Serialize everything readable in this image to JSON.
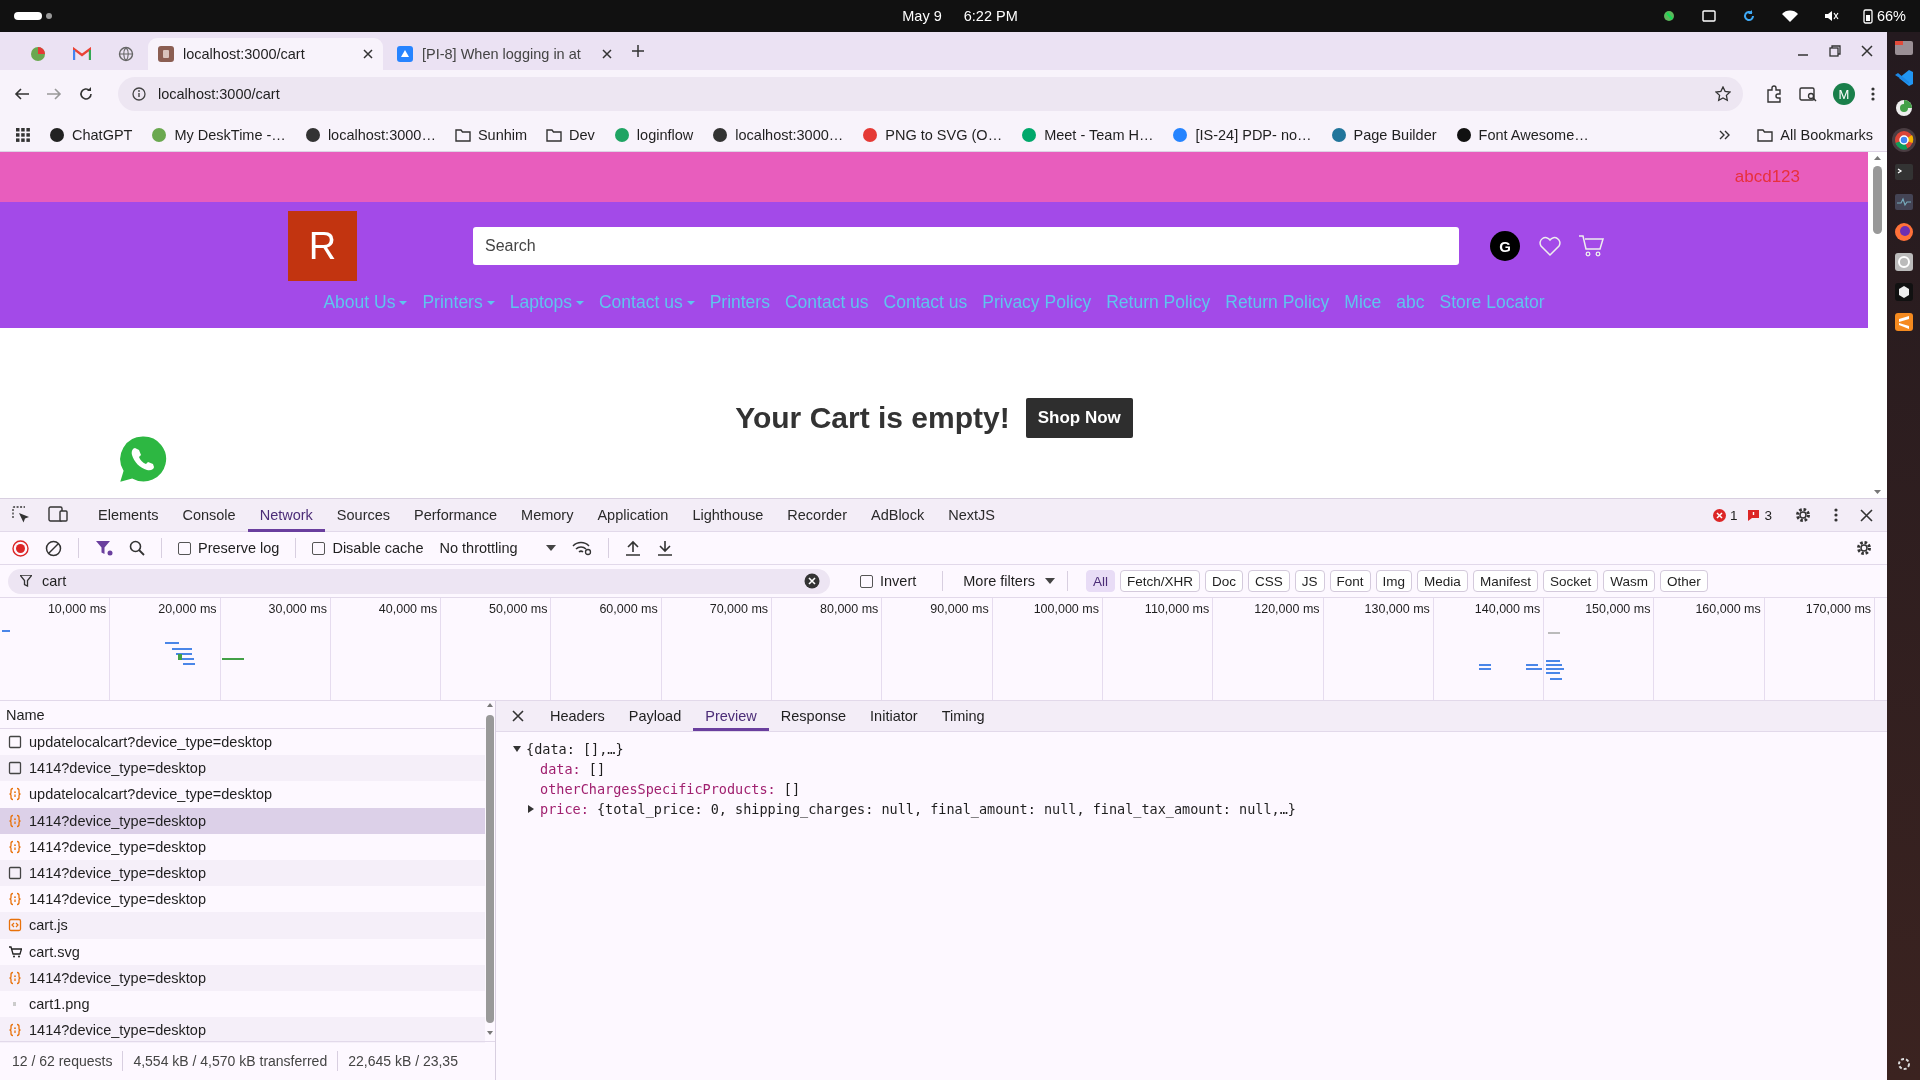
{
  "system_bar": {
    "date": "May 9",
    "time": "6:22 PM",
    "battery": "66%"
  },
  "tabs": [
    {
      "title": "localhost:3000/cart",
      "selected": true
    },
    {
      "title": "[PI-8] When logging in at",
      "selected": false
    }
  ],
  "address": "localhost:3000/cart",
  "profile_initial": "M",
  "bookmarks": [
    {
      "label": "ChatGPT",
      "kind": "site",
      "color": "#222222"
    },
    {
      "label": "My DeskTime -…",
      "kind": "site",
      "color": "#6aa84f"
    },
    {
      "label": "localhost:3000…",
      "kind": "site",
      "color": "#333333"
    },
    {
      "label": "Sunhim",
      "kind": "folder"
    },
    {
      "label": "Dev",
      "kind": "folder"
    },
    {
      "label": "loginflow",
      "kind": "site",
      "color": "#1fa463"
    },
    {
      "label": "localhost:3000…",
      "kind": "site",
      "color": "#333333"
    },
    {
      "label": "PNG to SVG (O…",
      "kind": "site",
      "color": "#e53935"
    },
    {
      "label": "Meet - Team H…",
      "kind": "site",
      "color": "#00a86b"
    },
    {
      "label": "[IS-24] PDP- no…",
      "kind": "site",
      "color": "#2684ff"
    },
    {
      "label": "Page Builder",
      "kind": "site",
      "color": "#21759b"
    },
    {
      "label": "Font Awesome…",
      "kind": "site",
      "color": "#111111"
    }
  ],
  "all_bookmarks": "All Bookmarks",
  "site": {
    "promo": "abcd123",
    "logo": "R",
    "search_placeholder": "Search",
    "account_initial": "G",
    "nav": [
      {
        "label": "About Us",
        "dropdown": true
      },
      {
        "label": "Printers",
        "dropdown": true
      },
      {
        "label": "Laptops",
        "dropdown": true
      },
      {
        "label": "Contact us",
        "dropdown": true
      },
      {
        "label": "Printers",
        "dropdown": false
      },
      {
        "label": "Contact us",
        "dropdown": false
      },
      {
        "label": "Contact us",
        "dropdown": false
      },
      {
        "label": "Privacy Policy",
        "dropdown": false
      },
      {
        "label": "Return Policy",
        "dropdown": false
      },
      {
        "label": "Return Policy",
        "dropdown": false
      },
      {
        "label": "Mice",
        "dropdown": false
      },
      {
        "label": "abc",
        "dropdown": false
      },
      {
        "label": "Store Locator",
        "dropdown": false
      }
    ],
    "empty_message": "Your Cart is empty!",
    "shop_button": "Shop Now"
  },
  "devtools": {
    "panels": [
      {
        "label": "Elements",
        "selected": false
      },
      {
        "label": "Console",
        "selected": false
      },
      {
        "label": "Network",
        "selected": true
      },
      {
        "label": "Sources",
        "selected": false
      },
      {
        "label": "Performance",
        "selected": false
      },
      {
        "label": "Memory",
        "selected": false
      },
      {
        "label": "Application",
        "selected": false
      },
      {
        "label": "Lighthouse",
        "selected": false
      },
      {
        "label": "Recorder",
        "selected": false
      },
      {
        "label": "AdBlock",
        "selected": false
      },
      {
        "label": "NextJS",
        "selected": false
      }
    ],
    "errors": "1",
    "warnings": "3",
    "preserve_log": {
      "label": "Preserve log",
      "checked": false
    },
    "disable_cache": {
      "label": "Disable cache",
      "checked": false
    },
    "throttling": "No throttling",
    "filter": "cart",
    "invert": {
      "label": "Invert",
      "checked": false
    },
    "more_filters": "More filters",
    "types": [
      {
        "label": "All",
        "selected": true
      },
      {
        "label": "Fetch/XHR",
        "selected": false
      },
      {
        "label": "Doc",
        "selected": false
      },
      {
        "label": "CSS",
        "selected": false
      },
      {
        "label": "JS",
        "selected": false
      },
      {
        "label": "Font",
        "selected": false
      },
      {
        "label": "Img",
        "selected": false
      },
      {
        "label": "Media",
        "selected": false
      },
      {
        "label": "Manifest",
        "selected": false
      },
      {
        "label": "Socket",
        "selected": false
      },
      {
        "label": "Wasm",
        "selected": false
      },
      {
        "label": "Other",
        "selected": false
      }
    ],
    "timeline_ticks": [
      "10,000 ms",
      "20,000 ms",
      "30,000 ms",
      "40,000 ms",
      "50,000 ms",
      "60,000 ms",
      "70,000 ms",
      "80,000 ms",
      "90,000 ms",
      "100,000 ms",
      "110,000 ms",
      "120,000 ms",
      "130,000 ms",
      "140,000 ms",
      "150,000 ms",
      "160,000 ms",
      "170,000 ms"
    ],
    "name_header": "Name",
    "requests": [
      {
        "name": "updatelocalcart?device_type=desktop",
        "kind": "doc",
        "selected": false
      },
      {
        "name": "1414?device_type=desktop",
        "kind": "doc",
        "selected": false
      },
      {
        "name": "updatelocalcart?device_type=desktop",
        "kind": "fetch",
        "selected": false
      },
      {
        "name": "1414?device_type=desktop",
        "kind": "fetch",
        "selected": true
      },
      {
        "name": "1414?device_type=desktop",
        "kind": "fetch",
        "selected": false
      },
      {
        "name": "1414?device_type=desktop",
        "kind": "doc",
        "selected": false
      },
      {
        "name": "1414?device_type=desktop",
        "kind": "fetch",
        "selected": false
      },
      {
        "name": "cart.js",
        "kind": "script",
        "selected": false
      },
      {
        "name": "cart.svg",
        "kind": "image",
        "selected": false
      },
      {
        "name": "1414?device_type=desktop",
        "kind": "fetch",
        "selected": false
      },
      {
        "name": "cart1.png",
        "kind": "png",
        "selected": false
      },
      {
        "name": "1414?device_type=desktop",
        "kind": "fetch",
        "selected": false
      }
    ],
    "detail_tabs": [
      {
        "label": "Headers",
        "selected": false
      },
      {
        "label": "Payload",
        "selected": false
      },
      {
        "label": "Preview",
        "selected": true
      },
      {
        "label": "Response",
        "selected": false
      },
      {
        "label": "Initiator",
        "selected": false
      },
      {
        "label": "Timing",
        "selected": false
      }
    ],
    "preview": {
      "root": "{data: [],…}",
      "expanded": true,
      "children": [
        {
          "key": "data:",
          "value": "[]"
        },
        {
          "key": "otherChargesSpecificProducts:",
          "value": "[]"
        },
        {
          "key": "price:",
          "value": "{total_price: 0, shipping_charges: null, final_amount: null, final_tax_amount: null,…}",
          "expanded": false
        }
      ]
    },
    "status": [
      "12 / 62 requests",
      "4,554 kB / 4,570 kB transferred",
      "22,645 kB / 23,35"
    ]
  }
}
